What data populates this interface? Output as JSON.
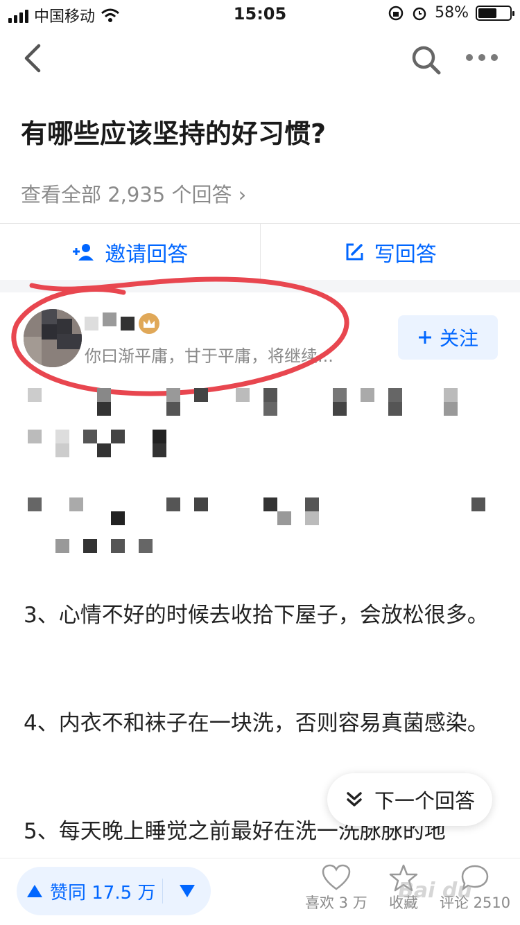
{
  "status_bar": {
    "carrier": "中国移动",
    "time": "15:05",
    "battery": "58%",
    "battery_level": 0.58
  },
  "question": {
    "title": "有哪些应该坚持的好习惯?",
    "all_answers": "查看全部 2,935 个回答 ›"
  },
  "actions": {
    "invite": "邀请回答",
    "write": "写回答"
  },
  "author": {
    "bio": "你曰渐平庸，甘于平庸，将继续...",
    "follow_label": "关注"
  },
  "content": {
    "item3": "3、心情不好的时候去收拾下屋子，会放松很多。",
    "item4": "4、内衣不和袜子在一块洗，否则容易真菌感染。",
    "item5": "5、每天晚上睡觉之前最好在洗一洗脉脉的地"
  },
  "next_answer": "下一个回答",
  "bottom": {
    "vote_label": "赞同 17.5 万",
    "like_label": "喜欢 3 万",
    "collect_label": "收藏",
    "comment_label": "评论 2510"
  },
  "colors": {
    "brand": "#0066ff",
    "annotation": "#e8464f"
  }
}
